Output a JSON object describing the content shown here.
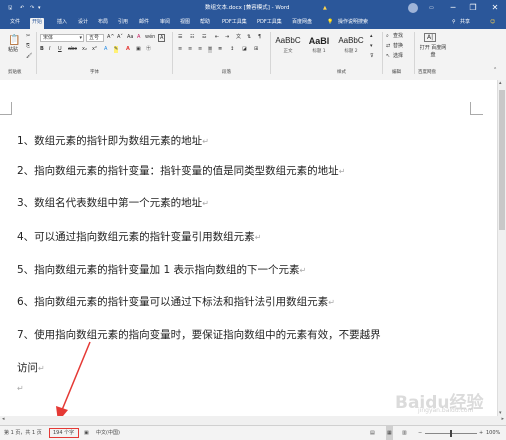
{
  "titlebar": {
    "qat": [
      "保存",
      "撤销",
      "重复"
    ],
    "title": "数组文本.docx [兼容模式] - Word",
    "warning": "▲",
    "min": "─",
    "restore": "❐",
    "close": "✕"
  },
  "tabs": [
    "文件",
    "开始",
    "插入",
    "设计",
    "布局",
    "引用",
    "邮件",
    "审阅",
    "视图",
    "帮助",
    "PDF工具集",
    "PDF工具集",
    "百度网盘"
  ],
  "tell_me": "操作说明搜索",
  "share": "共享",
  "ribbon": {
    "clipboard": {
      "paste": "粘贴",
      "label": "剪贴板"
    },
    "font": {
      "font_name": "宋体",
      "font_size": "五号",
      "bold": "B",
      "italic": "I",
      "underline": "U",
      "strike": "abc",
      "sub": "x₂",
      "sup": "x²",
      "grow": "A^",
      "shrink": "A˅",
      "case": "Aa",
      "clear": "A",
      "wen": "wén",
      "char_border": "A",
      "label": "字体"
    },
    "paragraph": {
      "label": "段落"
    },
    "styles": {
      "items": [
        {
          "sample": "AaBbC",
          "name": "正文"
        },
        {
          "sample": "AaBl",
          "name": "标题 1"
        },
        {
          "sample": "AaBbC",
          "name": "标题 2"
        }
      ],
      "label": "样式"
    },
    "editing": {
      "find": "查找",
      "replace": "替换",
      "select": "选择",
      "label": "编辑"
    },
    "save_group": {
      "btn": "打开 百度网盘",
      "label": "百度网盘"
    }
  },
  "document": {
    "paragraphs": [
      "1、数组元素的指针即为数组元素的地址",
      "2、指向数组元素的指针变量：指针变量的值是同类型数组元素的地址",
      "3、数组名代表数组中第一个元素的地址",
      "4、可以通过指向数组元素的指针变量引用数组元素",
      "5、指向数组元素的指针变量加 1 表示指向数组的下一个元素",
      "6、指向数组元素的指针变量可以通过下标法和指针法引用数组元素",
      "7、使用指向数组元素的指向变量时，要保证指向数组中的元素有效，不要越界",
      "访问"
    ],
    "return_mark": "↵"
  },
  "statusbar": {
    "page": "第 1 页，共 1 页",
    "words": "194 个字",
    "lang": "中文(中国)",
    "zoom": "100%"
  },
  "watermark": {
    "text": "Baidu经验",
    "sub": "jingyan.baidu.com"
  },
  "colors": {
    "accent": "#2b579a",
    "highlight": "#e53935"
  }
}
